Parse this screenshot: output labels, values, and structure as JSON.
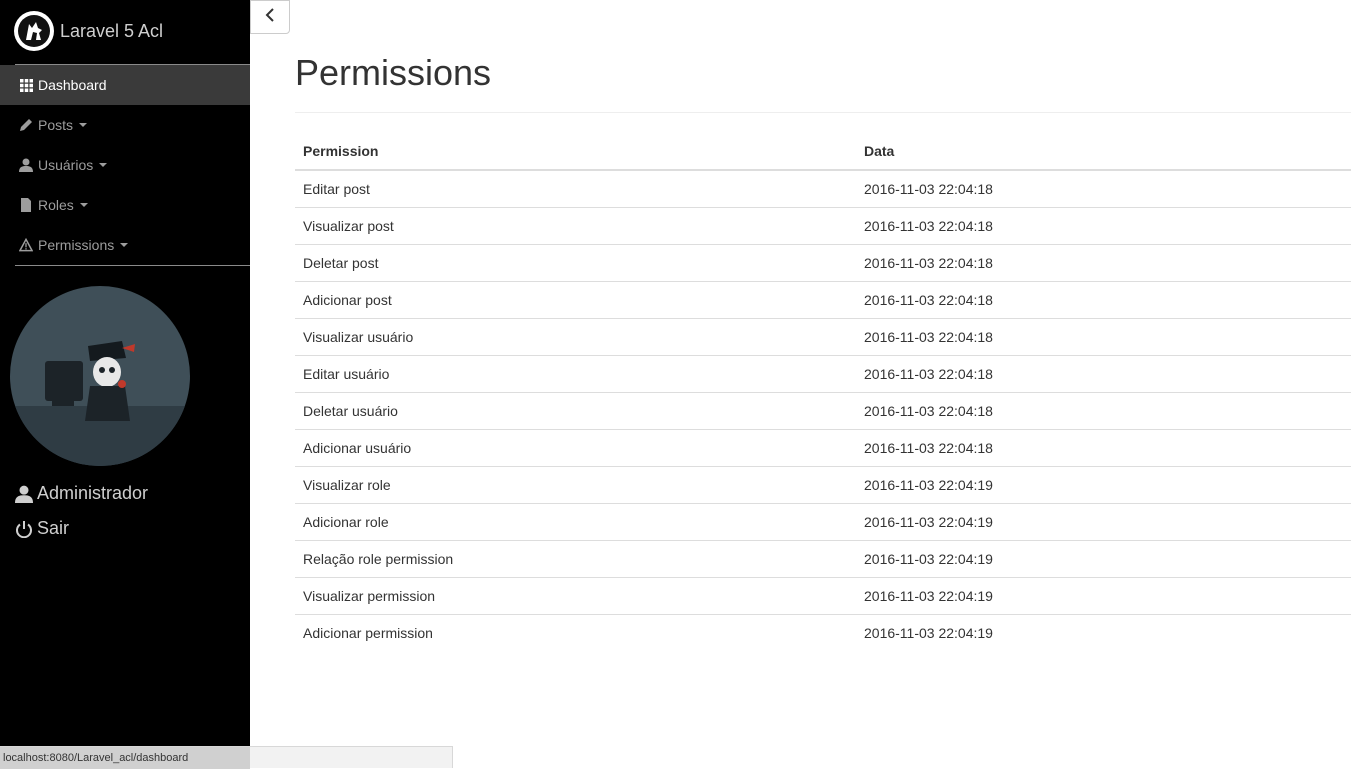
{
  "brand": {
    "name": "Laravel 5 Acl",
    "logo": "wolf-logo-icon"
  },
  "sidebar": {
    "items": [
      {
        "label": "Dashboard",
        "icon": "grid-icon",
        "active": true,
        "dropdown": false
      },
      {
        "label": "Posts",
        "icon": "pencil-icon",
        "active": false,
        "dropdown": true
      },
      {
        "label": "Usuários",
        "icon": "user-icon",
        "active": false,
        "dropdown": true
      },
      {
        "label": "Roles",
        "icon": "file-icon",
        "active": false,
        "dropdown": true
      },
      {
        "label": "Permissions",
        "icon": "warning-icon",
        "active": false,
        "dropdown": true
      }
    ],
    "user_name": "Administrador",
    "logout_label": "Sair"
  },
  "page": {
    "title": "Permissions"
  },
  "table": {
    "headers": [
      "Permission",
      "Data"
    ],
    "rows": [
      {
        "permission": "Editar post",
        "date": "2016-11-03 22:04:18"
      },
      {
        "permission": "Visualizar post",
        "date": "2016-11-03 22:04:18"
      },
      {
        "permission": "Deletar post",
        "date": "2016-11-03 22:04:18"
      },
      {
        "permission": "Adicionar post",
        "date": "2016-11-03 22:04:18"
      },
      {
        "permission": "Visualizar usuário",
        "date": "2016-11-03 22:04:18"
      },
      {
        "permission": "Editar usuário",
        "date": "2016-11-03 22:04:18"
      },
      {
        "permission": "Deletar usuário",
        "date": "2016-11-03 22:04:18"
      },
      {
        "permission": "Adicionar usuário",
        "date": "2016-11-03 22:04:18"
      },
      {
        "permission": "Visualizar role",
        "date": "2016-11-03 22:04:19"
      },
      {
        "permission": "Adicionar role",
        "date": "2016-11-03 22:04:19"
      },
      {
        "permission": "Relação role permission",
        "date": "2016-11-03 22:04:19"
      },
      {
        "permission": "Visualizar permission",
        "date": "2016-11-03 22:04:19"
      },
      {
        "permission": "Adicionar permission",
        "date": "2016-11-03 22:04:19"
      }
    ]
  },
  "status_bar": {
    "url": "localhost:8080/Laravel_acl/dashboard"
  },
  "colors": {
    "sidebar_bg": "#000000",
    "active_item_bg": "#3a3a3a",
    "avatar_bg": "#3f4f58"
  }
}
